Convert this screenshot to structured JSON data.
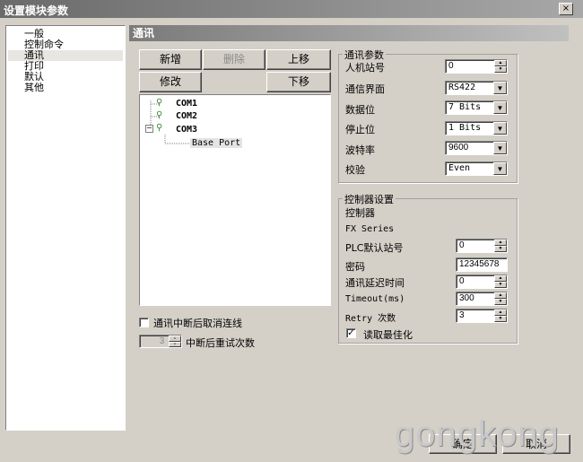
{
  "window": {
    "title": "设置模块参数",
    "close": "×"
  },
  "nav": {
    "items": [
      "一般",
      "控制命令",
      "通讯",
      "打印",
      "默认",
      "其他"
    ],
    "selected": "通讯"
  },
  "section": {
    "title": "通讯"
  },
  "buttons": {
    "add": "新增",
    "delete": "删除",
    "move_up": "上移",
    "edit": "修改",
    "move_down": "下移"
  },
  "tree": {
    "nodes": [
      "COM1",
      "COM2",
      "COM3"
    ],
    "child": "Base Port"
  },
  "comm_params": {
    "legend": "通讯参数",
    "hmi_station": {
      "label": "人机站号",
      "value": "0"
    },
    "interface": {
      "label": "通信界面",
      "value": "RS422"
    },
    "data_bits": {
      "label": "数据位",
      "value": "7 Bits"
    },
    "stop_bits": {
      "label": "停止位",
      "value": "1 Bits"
    },
    "baud_rate": {
      "label": "波特率",
      "value": "9600"
    },
    "parity": {
      "label": "校验",
      "value": "Even"
    }
  },
  "controller": {
    "legend": "控制器设置",
    "name_label": "控制器",
    "name_value": "FX Series",
    "plc_station": {
      "label": "PLC默认站号",
      "value": "0"
    },
    "password": {
      "label": "密码",
      "value": "12345678"
    },
    "comm_delay": {
      "label": "通讯延迟时间",
      "value": "0"
    },
    "timeout": {
      "label": "Timeout(ms)",
      "value": "300"
    },
    "retry": {
      "label": "Retry 次数",
      "value": "3"
    },
    "optimize": {
      "label": "读取最佳化",
      "checked": true
    }
  },
  "disconnect": {
    "label": "通讯中断后取消连线",
    "checked": false
  },
  "retry_after": {
    "label": "中断后重试次数",
    "value": "3"
  },
  "footer": {
    "ok": "确定",
    "cancel": "取消"
  },
  "watermark": "gongkong"
}
